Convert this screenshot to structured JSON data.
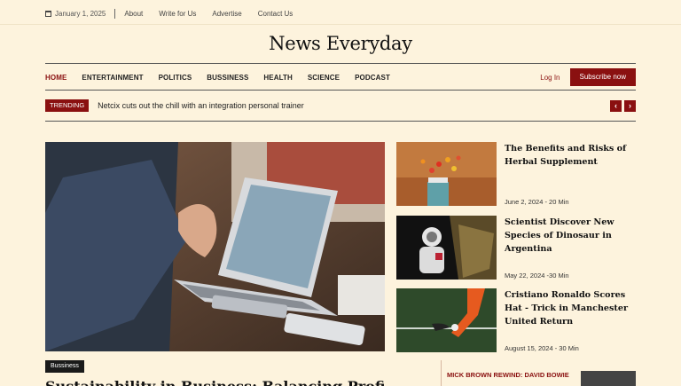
{
  "topbar": {
    "date": "January 1, 2025",
    "links": [
      "About",
      "Write for Us",
      "Advertise",
      "Contact Us"
    ]
  },
  "site": {
    "title": "News Everyday"
  },
  "nav": {
    "items": [
      "HOME",
      "ENTERTAINMENT",
      "POLITICS",
      "BUSSINESS",
      "HEALTH",
      "SCIENCE",
      "PODCAST"
    ],
    "active": "HOME",
    "login": "Log In",
    "subscribe": "Subscribe now"
  },
  "trending": {
    "label": "TRENDING",
    "headline": "Netcix cuts out the chill with an integration personal trainer",
    "prev": "‹",
    "next": "›"
  },
  "hero": {
    "category": "Bussiness",
    "title": "Sustainability in Business: Balancing Profit and"
  },
  "articles": [
    {
      "title": "The Benefits and Risks of Herbal Supplement",
      "meta": "June 2, 2024 - 20 Min"
    },
    {
      "title": "Scientist Discover New Species of Dinosaur in Argentina",
      "meta": "May 22, 2024 -30 Min"
    },
    {
      "title": "Cristiano Ronaldo Scores Hat - Trick in Manchester United Return",
      "meta": "August 15, 2024 - 30 Min"
    }
  ],
  "side_section": {
    "label": "MICK BROWN REWIND: DAVID BOWIE"
  },
  "colors": {
    "accent": "#8a1010",
    "background": "#fdf3dd"
  }
}
